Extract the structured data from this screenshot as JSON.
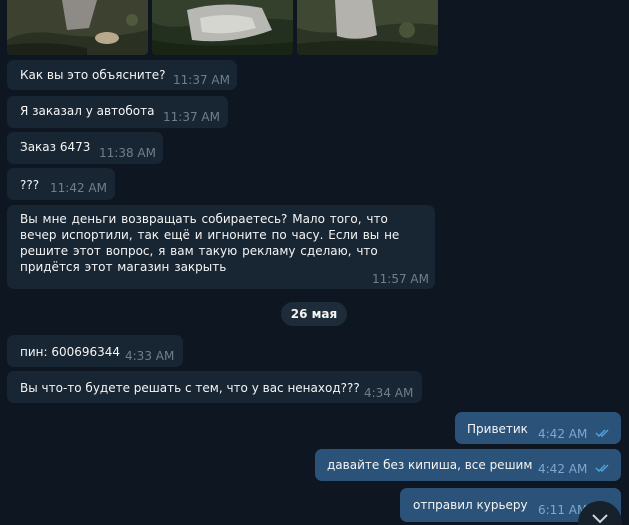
{
  "photos": [
    "photo-1",
    "photo-2",
    "photo-3"
  ],
  "messages": [
    {
      "text": "Как вы это объясните?",
      "time": "11:37 AM",
      "dir": "in"
    },
    {
      "text": "Я заказал  у автобота",
      "time": "11:37 AM",
      "dir": "in"
    },
    {
      "text": "Заказ 6473",
      "time": "11:38 AM",
      "dir": "in"
    },
    {
      "text": "???",
      "time": "11:42 AM",
      "dir": "in"
    },
    {
      "text": "Вы мне деньги возвращать собираетесь?  Мало того,  что вечер испортили,  так ещё и игноните по часу.  Если вы не решите этот вопрос, я вам такую  рекламу сделаю,  что придётся  этот магазин  закрыть",
      "time": "11:57 AM",
      "dir": "in"
    },
    {
      "text": "пин: 600696344",
      "time": "4:33 AM",
      "dir": "in"
    },
    {
      "text": "Вы что-то  будете решать с тем,  что у вас ненаход???",
      "time": "4:34 AM",
      "dir": "in"
    },
    {
      "text": "Приветик",
      "time": "4:42 AM",
      "dir": "out"
    },
    {
      "text": "давайте без кипиша, все решим",
      "time": "4:42 AM",
      "dir": "out"
    },
    {
      "text": "отправил курьеру",
      "time": "6:11 AM",
      "dir": "out"
    }
  ],
  "date_separator": "26 мая",
  "colors": {
    "background": "#0e1621",
    "incoming_bubble": "#182533",
    "outgoing_bubble": "#2b5278",
    "read_check": "#4fa3e0"
  },
  "icons": {
    "read_receipt": "double-check-icon",
    "scroll_down": "chevron-down-icon"
  }
}
